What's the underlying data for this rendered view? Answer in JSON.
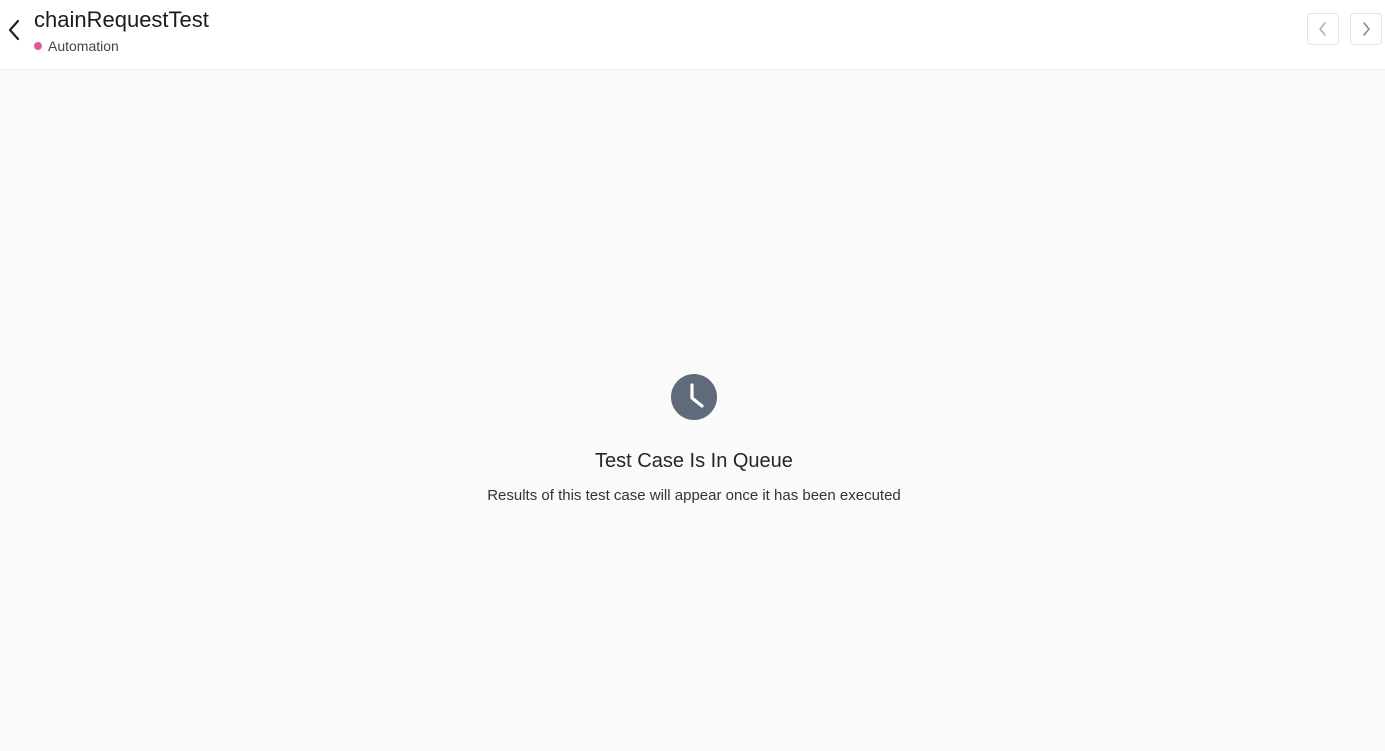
{
  "header": {
    "title": "chainRequestTest",
    "subtitle": "Automation",
    "status_dot_color": "#d85c9a",
    "back_icon": "chevron-left-icon",
    "prev_icon": "chevron-left-icon",
    "next_icon": "chevron-right-icon"
  },
  "empty_state": {
    "icon": "clock-icon",
    "icon_color": "#5f6b7a",
    "title": "Test Case Is In Queue",
    "message": "Results of this test case will appear once it has been executed"
  }
}
